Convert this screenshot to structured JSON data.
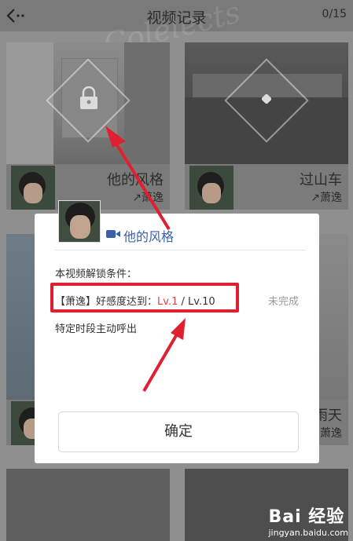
{
  "header": {
    "title": "视频记录",
    "count": "0/15",
    "watermark": "Colelects"
  },
  "cards": [
    {
      "title": "他的风格",
      "author": "萧逸"
    },
    {
      "title": "过山车",
      "author": "萧逸"
    },
    {
      "title": "",
      "author": ""
    },
    {
      "title": "雨天",
      "author": "萧逸"
    }
  ],
  "modal": {
    "video_title": "他的风格",
    "condition_label": "本视频解锁条件：",
    "requirement_prefix": "【萧逸】好感度达到：",
    "current_level": "Lv.1",
    "separator": " / ",
    "target_level": "Lv.10",
    "status": "未完成",
    "note": "特定时段主动呼出",
    "confirm_label": "确定"
  },
  "watermark_corner": {
    "brand": "Bai 经验",
    "site": "jingyan.baidu.com"
  },
  "colors": {
    "accent_red": "#e02030",
    "link_blue": "#3a5fa8"
  }
}
